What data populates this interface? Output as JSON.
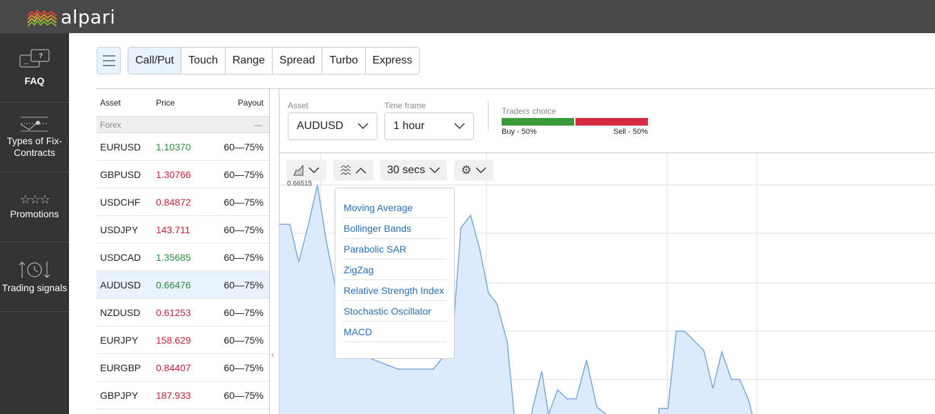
{
  "header": {
    "brand": "alpari",
    "logo_icon": "alpari-wave-logo"
  },
  "sidebar": {
    "items": [
      {
        "label": "FAQ",
        "icon": "faq-chat-icon"
      },
      {
        "label": "Types of Fix-Contracts",
        "icon": "contract-chart-icon"
      },
      {
        "label": "Promotions",
        "icon": "stars-icon"
      },
      {
        "label": "Trading signals",
        "icon": "signals-clock-icon"
      }
    ]
  },
  "toolbar": {
    "menu_icon": "hamburger-icon",
    "tabs": [
      "Call/Put",
      "Touch",
      "Range",
      "Spread",
      "Turbo",
      "Express"
    ],
    "active_tab": "Call/Put"
  },
  "asset_list": {
    "headers": [
      "Asset",
      "Price",
      "Payout"
    ],
    "group": {
      "label": "Forex",
      "toggle": "—"
    },
    "rows": [
      {
        "asset": "EURUSD",
        "price": "1.10370",
        "payout": "60—75%",
        "trend": "up"
      },
      {
        "asset": "GBPUSD",
        "price": "1.30766",
        "payout": "60—75%",
        "trend": "down"
      },
      {
        "asset": "USDCHF",
        "price": "0.84872",
        "payout": "60—75%",
        "trend": "down"
      },
      {
        "asset": "USDJPY",
        "price": "143.711",
        "payout": "60—75%",
        "trend": "down"
      },
      {
        "asset": "USDCAD",
        "price": "1.35685",
        "payout": "60—75%",
        "trend": "up"
      },
      {
        "asset": "AUDUSD",
        "price": "0.66476",
        "payout": "60—75%",
        "trend": "up",
        "selected": true
      },
      {
        "asset": "NZDUSD",
        "price": "0.61253",
        "payout": "60—75%",
        "trend": "down"
      },
      {
        "asset": "EURJPY",
        "price": "158.629",
        "payout": "60—75%",
        "trend": "down"
      },
      {
        "asset": "EURGBP",
        "price": "0.84407",
        "payout": "60—75%",
        "trend": "down"
      },
      {
        "asset": "GBPJPY",
        "price": "187.933",
        "payout": "60—75%",
        "trend": "down"
      }
    ]
  },
  "selectors": {
    "asset_label": "Asset",
    "asset_value": "AUDUSD",
    "timeframe_label": "Time frame",
    "timeframe_value": "1 hour"
  },
  "traders_choice": {
    "title": "Traders choice",
    "buy_label": "Buy - 50%",
    "sell_label": "Sell - 50%",
    "buy_percent": 50,
    "sell_percent": 50,
    "buy_color": "#3a9a3a",
    "sell_color": "#d62b40"
  },
  "chart": {
    "interval": "30 secs",
    "max_price_label": "0.66515",
    "line_color": "#7aa7dd",
    "fill_color": "#dcebfb"
  },
  "indicators_menu": {
    "items": [
      "Moving Average",
      "Bollinger Bands",
      "Parabolic SAR",
      "ZigZag",
      "Relative Strength Index",
      "Stochastic Oscillator",
      "MACD"
    ]
  }
}
